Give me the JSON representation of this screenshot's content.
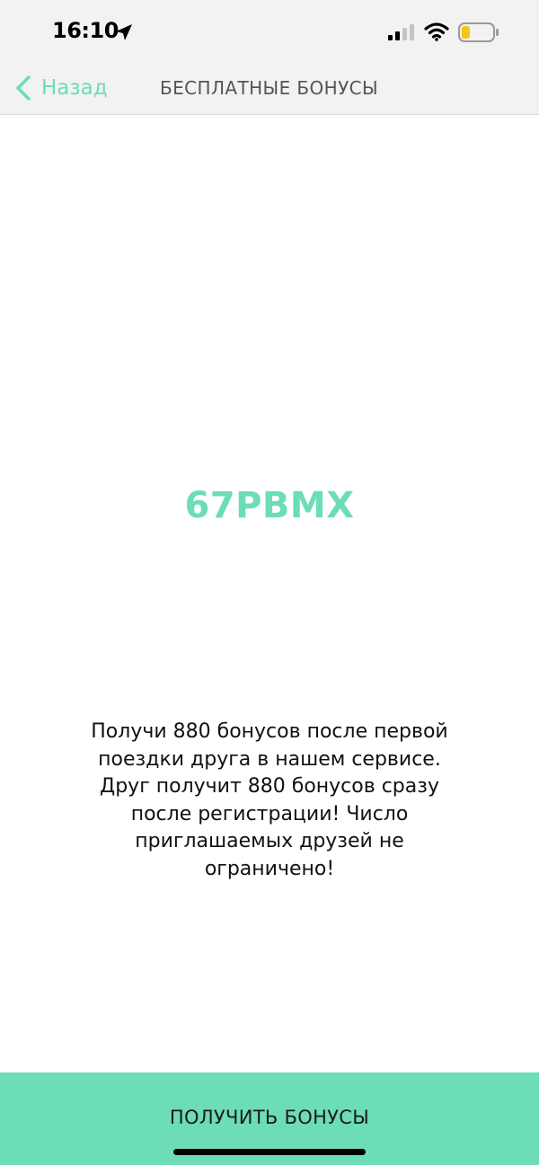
{
  "status_bar": {
    "time": "16:10",
    "icons": [
      "location-arrow-icon",
      "cellular-signal-icon",
      "wifi-icon",
      "battery-low-icon"
    ]
  },
  "nav": {
    "back_label": "Назад",
    "title": "БЕСПЛАТНЫЕ БОНУСЫ"
  },
  "promo": {
    "code": "67PBMX",
    "description": "Получи 880 бонусов после первой поездки друга в нашем сервисе. Друг получит 880 бонусов сразу после регистрации! Число приглашаемых друзей не ограничено!"
  },
  "action": {
    "button_label": "ПОЛУЧИТЬ БОНУСЫ"
  },
  "colors": {
    "accent": "#6cdcb9",
    "bar_background": "#f2f2f2",
    "battery_fill": "#f5c518"
  }
}
